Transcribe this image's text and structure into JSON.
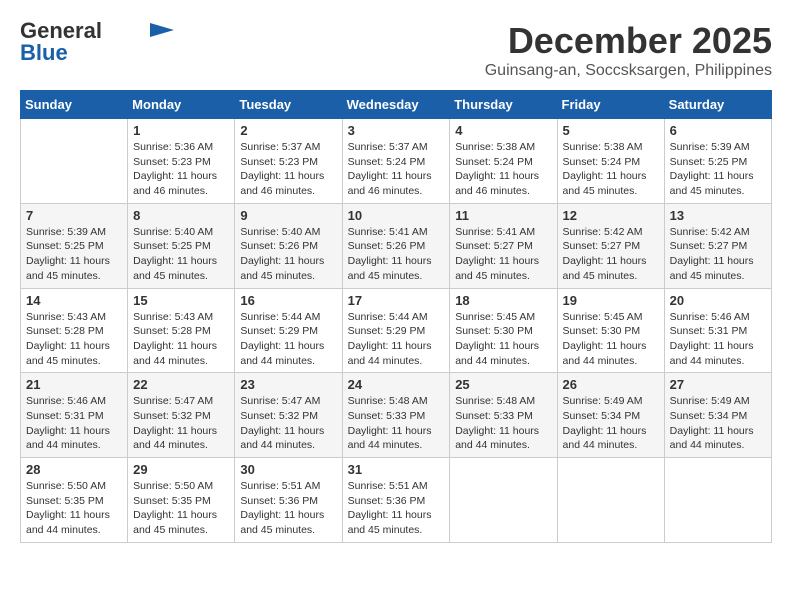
{
  "header": {
    "logo_general": "General",
    "logo_blue": "Blue",
    "month_title": "December 2025",
    "location": "Guinsang-an, Soccsksargen, Philippines"
  },
  "calendar": {
    "days_of_week": [
      "Sunday",
      "Monday",
      "Tuesday",
      "Wednesday",
      "Thursday",
      "Friday",
      "Saturday"
    ],
    "weeks": [
      [
        {
          "day": "",
          "info": ""
        },
        {
          "day": "1",
          "info": "Sunrise: 5:36 AM\nSunset: 5:23 PM\nDaylight: 11 hours and 46 minutes."
        },
        {
          "day": "2",
          "info": "Sunrise: 5:37 AM\nSunset: 5:23 PM\nDaylight: 11 hours and 46 minutes."
        },
        {
          "day": "3",
          "info": "Sunrise: 5:37 AM\nSunset: 5:24 PM\nDaylight: 11 hours and 46 minutes."
        },
        {
          "day": "4",
          "info": "Sunrise: 5:38 AM\nSunset: 5:24 PM\nDaylight: 11 hours and 46 minutes."
        },
        {
          "day": "5",
          "info": "Sunrise: 5:38 AM\nSunset: 5:24 PM\nDaylight: 11 hours and 45 minutes."
        },
        {
          "day": "6",
          "info": "Sunrise: 5:39 AM\nSunset: 5:25 PM\nDaylight: 11 hours and 45 minutes."
        }
      ],
      [
        {
          "day": "7",
          "info": "Sunrise: 5:39 AM\nSunset: 5:25 PM\nDaylight: 11 hours and 45 minutes."
        },
        {
          "day": "8",
          "info": "Sunrise: 5:40 AM\nSunset: 5:25 PM\nDaylight: 11 hours and 45 minutes."
        },
        {
          "day": "9",
          "info": "Sunrise: 5:40 AM\nSunset: 5:26 PM\nDaylight: 11 hours and 45 minutes."
        },
        {
          "day": "10",
          "info": "Sunrise: 5:41 AM\nSunset: 5:26 PM\nDaylight: 11 hours and 45 minutes."
        },
        {
          "day": "11",
          "info": "Sunrise: 5:41 AM\nSunset: 5:27 PM\nDaylight: 11 hours and 45 minutes."
        },
        {
          "day": "12",
          "info": "Sunrise: 5:42 AM\nSunset: 5:27 PM\nDaylight: 11 hours and 45 minutes."
        },
        {
          "day": "13",
          "info": "Sunrise: 5:42 AM\nSunset: 5:27 PM\nDaylight: 11 hours and 45 minutes."
        }
      ],
      [
        {
          "day": "14",
          "info": "Sunrise: 5:43 AM\nSunset: 5:28 PM\nDaylight: 11 hours and 45 minutes."
        },
        {
          "day": "15",
          "info": "Sunrise: 5:43 AM\nSunset: 5:28 PM\nDaylight: 11 hours and 44 minutes."
        },
        {
          "day": "16",
          "info": "Sunrise: 5:44 AM\nSunset: 5:29 PM\nDaylight: 11 hours and 44 minutes."
        },
        {
          "day": "17",
          "info": "Sunrise: 5:44 AM\nSunset: 5:29 PM\nDaylight: 11 hours and 44 minutes."
        },
        {
          "day": "18",
          "info": "Sunrise: 5:45 AM\nSunset: 5:30 PM\nDaylight: 11 hours and 44 minutes."
        },
        {
          "day": "19",
          "info": "Sunrise: 5:45 AM\nSunset: 5:30 PM\nDaylight: 11 hours and 44 minutes."
        },
        {
          "day": "20",
          "info": "Sunrise: 5:46 AM\nSunset: 5:31 PM\nDaylight: 11 hours and 44 minutes."
        }
      ],
      [
        {
          "day": "21",
          "info": "Sunrise: 5:46 AM\nSunset: 5:31 PM\nDaylight: 11 hours and 44 minutes."
        },
        {
          "day": "22",
          "info": "Sunrise: 5:47 AM\nSunset: 5:32 PM\nDaylight: 11 hours and 44 minutes."
        },
        {
          "day": "23",
          "info": "Sunrise: 5:47 AM\nSunset: 5:32 PM\nDaylight: 11 hours and 44 minutes."
        },
        {
          "day": "24",
          "info": "Sunrise: 5:48 AM\nSunset: 5:33 PM\nDaylight: 11 hours and 44 minutes."
        },
        {
          "day": "25",
          "info": "Sunrise: 5:48 AM\nSunset: 5:33 PM\nDaylight: 11 hours and 44 minutes."
        },
        {
          "day": "26",
          "info": "Sunrise: 5:49 AM\nSunset: 5:34 PM\nDaylight: 11 hours and 44 minutes."
        },
        {
          "day": "27",
          "info": "Sunrise: 5:49 AM\nSunset: 5:34 PM\nDaylight: 11 hours and 44 minutes."
        }
      ],
      [
        {
          "day": "28",
          "info": "Sunrise: 5:50 AM\nSunset: 5:35 PM\nDaylight: 11 hours and 44 minutes."
        },
        {
          "day": "29",
          "info": "Sunrise: 5:50 AM\nSunset: 5:35 PM\nDaylight: 11 hours and 45 minutes."
        },
        {
          "day": "30",
          "info": "Sunrise: 5:51 AM\nSunset: 5:36 PM\nDaylight: 11 hours and 45 minutes."
        },
        {
          "day": "31",
          "info": "Sunrise: 5:51 AM\nSunset: 5:36 PM\nDaylight: 11 hours and 45 minutes."
        },
        {
          "day": "",
          "info": ""
        },
        {
          "day": "",
          "info": ""
        },
        {
          "day": "",
          "info": ""
        }
      ]
    ]
  }
}
